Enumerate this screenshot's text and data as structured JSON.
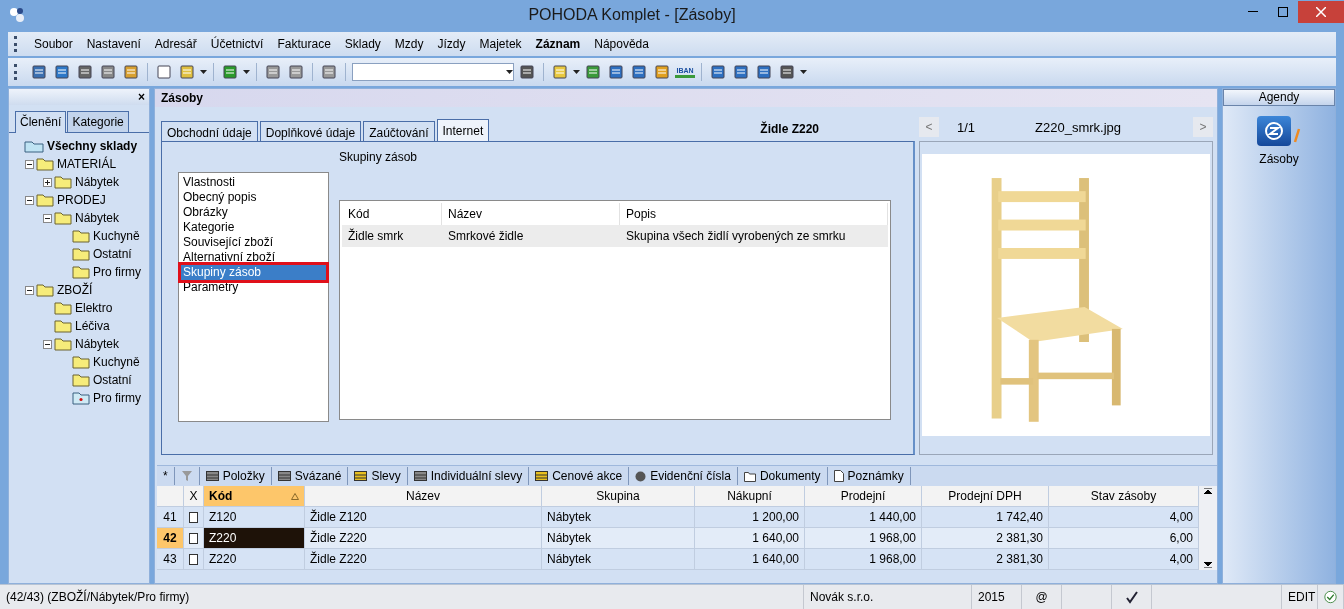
{
  "window": {
    "title": "POHODA Komplet - [Zásoby]"
  },
  "menu": [
    {
      "label": "Soubor",
      "bold": false
    },
    {
      "label": "Nastavení",
      "bold": false
    },
    {
      "label": "Adresář",
      "bold": false
    },
    {
      "label": "Účetnictví",
      "bold": false
    },
    {
      "label": "Fakturace",
      "bold": false
    },
    {
      "label": "Sklady",
      "bold": false
    },
    {
      "label": "Mzdy",
      "bold": false
    },
    {
      "label": "Jízdy",
      "bold": false
    },
    {
      "label": "Majetek",
      "bold": false
    },
    {
      "label": "Záznam",
      "bold": true
    },
    {
      "label": "Nápověda",
      "bold": false
    }
  ],
  "toolbar": {
    "iban_label": "IBAN"
  },
  "left_panel": {
    "close": "×",
    "tabs": [
      {
        "label": "Členění",
        "selected": true
      },
      {
        "label": "Kategorie",
        "selected": false
      }
    ],
    "tree": [
      {
        "label": "Všechny sklady",
        "selected": false,
        "children": [
          {
            "label": "MATERIÁL",
            "selected": false,
            "expanded": true,
            "children": [
              {
                "label": "Nábytek",
                "selected": false,
                "expanded": false
              }
            ]
          },
          {
            "label": "PRODEJ",
            "selected": false,
            "expanded": true,
            "children": [
              {
                "label": "Nábytek",
                "selected": false,
                "expanded": true,
                "children": [
                  {
                    "label": "Kuchyně",
                    "selected": false
                  },
                  {
                    "label": "Ostatní",
                    "selected": false
                  },
                  {
                    "label": "Pro firmy",
                    "selected": false
                  }
                ]
              }
            ]
          },
          {
            "label": "ZBOŽÍ",
            "selected": false,
            "expanded": true,
            "children": [
              {
                "label": "Elektro",
                "selected": false
              },
              {
                "label": "Léčiva",
                "selected": false
              },
              {
                "label": "Nábytek",
                "selected": false,
                "expanded": true,
                "children": [
                  {
                    "label": "Kuchyně",
                    "selected": false
                  },
                  {
                    "label": "Ostatní",
                    "selected": false
                  },
                  {
                    "label": "Pro firmy",
                    "selected": true
                  }
                ]
              }
            ]
          }
        ]
      }
    ]
  },
  "agenda": {
    "title": "Zásoby",
    "detail_tabs": [
      {
        "label": "Obchodní údaje",
        "selected": false
      },
      {
        "label": "Doplňkové údaje",
        "selected": false
      },
      {
        "label": "Zaúčtování",
        "selected": false
      },
      {
        "label": "Internet",
        "selected": true
      }
    ],
    "record_title": "Židle Z220",
    "sections": [
      {
        "label": "Vlastnosti",
        "selected": false
      },
      {
        "label": "Obecný popis",
        "selected": false
      },
      {
        "label": "Obrázky",
        "selected": false
      },
      {
        "label": "Kategorie",
        "selected": false
      },
      {
        "label": "Související zboží",
        "selected": false
      },
      {
        "label": "Alternativní zboží",
        "selected": false
      },
      {
        "label": "Skupiny zásob",
        "selected": true
      },
      {
        "label": "Parametry",
        "selected": false
      }
    ],
    "section_title": "Skupiny zásob",
    "groups_table": {
      "columns": [
        "Kód",
        "Název",
        "Popis"
      ],
      "rows": [
        [
          "Židle smrk",
          "Smrkové židle",
          "Skupina všech židlí vyrobených ze smrku"
        ]
      ]
    },
    "image_nav": {
      "prev": "<",
      "counter": "1/1",
      "filename": "Z220_smrk.jpg",
      "next": ">"
    }
  },
  "bottom_tabs": {
    "new": "*",
    "tabs": [
      {
        "label": "Položky",
        "selected": false
      },
      {
        "label": "Svázané",
        "selected": false
      },
      {
        "label": "Slevy",
        "selected": false
      },
      {
        "label": "Individuální slevy",
        "selected": false
      },
      {
        "label": "Cenové akce",
        "selected": false
      },
      {
        "label": "Evidenční čísla",
        "selected": false
      },
      {
        "label": "Dokumenty",
        "selected": false
      },
      {
        "label": "Poznámky",
        "selected": false
      }
    ]
  },
  "grid": {
    "columns": [
      {
        "sorted": false
      },
      {
        "label": "X",
        "sorted": false
      },
      {
        "label": "Kód",
        "sorted": true
      },
      {
        "label": "Název",
        "sorted": false
      },
      {
        "label": "Skupina",
        "sorted": false
      },
      {
        "label": "Nákupní",
        "sorted": false
      },
      {
        "label": "Prodejní",
        "sorted": false
      },
      {
        "label": "Prodejní DPH",
        "sorted": false
      },
      {
        "label": "Stav zásoby",
        "sorted": false
      }
    ],
    "rows": [
      {
        "selected": false,
        "cells": [
          "41",
          {
            "checked": false
          },
          "Z120",
          "Židle Z120",
          "Nábytek",
          "1 200,00",
          "1 440,00",
          "1 742,40",
          "4,00"
        ]
      },
      {
        "selected": true,
        "cells": [
          "42",
          {
            "checked": false
          },
          "Z220",
          "Židle Z220",
          "Nábytek",
          "1 640,00",
          "1 968,00",
          "2 381,30",
          "6,00"
        ]
      },
      {
        "selected": false,
        "cells": [
          "43",
          {
            "checked": false
          },
          "Z220",
          "Židle Z220",
          "Nábytek",
          "1 640,00",
          "1 968,00",
          "2 381,30",
          "4,00"
        ]
      }
    ]
  },
  "agendas_panel": {
    "title": "Agendy",
    "item": "Zásoby"
  },
  "status_bar": {
    "record": "(42/43) (ZBOŽÍ/Nábytek/Pro firmy)",
    "company": "Novák s.r.o.",
    "year": "2015",
    "at": "@",
    "mode": "EDIT"
  }
}
